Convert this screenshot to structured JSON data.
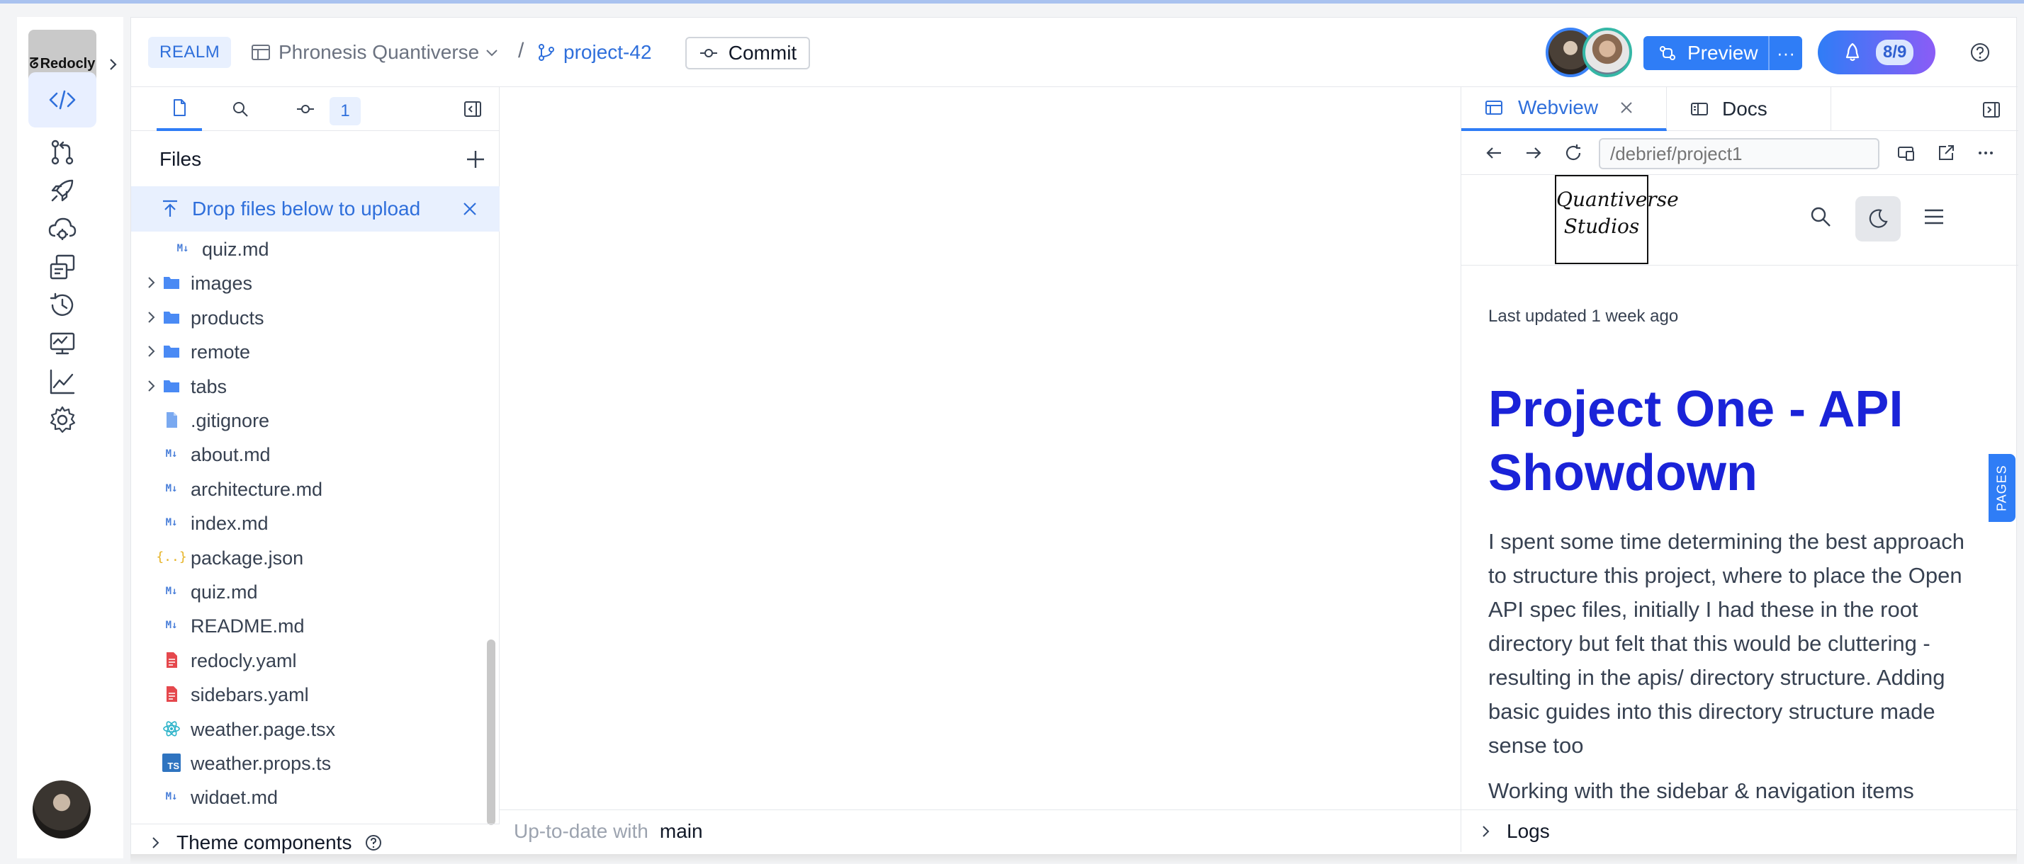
{
  "rail": {
    "logo_text": "Redocly",
    "items": [
      {
        "name": "code-icon",
        "active": true
      },
      {
        "name": "pull-request-icon",
        "active": false
      },
      {
        "name": "rocket-icon",
        "active": false
      },
      {
        "name": "cloud-gear-icon",
        "active": false
      },
      {
        "name": "api-icon",
        "active": false
      },
      {
        "name": "history-icon",
        "active": false
      },
      {
        "name": "monitor-icon",
        "active": false
      },
      {
        "name": "analytics-icon",
        "active": false
      },
      {
        "name": "settings-icon",
        "active": false
      }
    ]
  },
  "header": {
    "realm": "REALM",
    "project": "Phronesis Quantiverse",
    "separator": "/",
    "branch": "project-42",
    "commit_label": "Commit",
    "preview_label": "Preview",
    "preview_more": "···",
    "notif_count": "8/9"
  },
  "files_panel": {
    "change_count": "1",
    "title": "Files",
    "drop_banner": "Drop files below to upload",
    "tree": [
      {
        "type": "md",
        "name": "quiz.md",
        "indent": 1
      },
      {
        "type": "folder",
        "name": "images",
        "indent": 0
      },
      {
        "type": "folder",
        "name": "products",
        "indent": 0
      },
      {
        "type": "folder",
        "name": "remote",
        "indent": 0
      },
      {
        "type": "folder",
        "name": "tabs",
        "indent": 0
      },
      {
        "type": "file",
        "name": ".gitignore",
        "indent": 0
      },
      {
        "type": "md",
        "name": "about.md",
        "indent": 0
      },
      {
        "type": "md",
        "name": "architecture.md",
        "indent": 0
      },
      {
        "type": "md",
        "name": "index.md",
        "indent": 0
      },
      {
        "type": "json",
        "name": "package.json",
        "indent": 0
      },
      {
        "type": "md",
        "name": "quiz.md",
        "indent": 0
      },
      {
        "type": "md",
        "name": "README.md",
        "indent": 0
      },
      {
        "type": "yaml",
        "name": "redocly.yaml",
        "indent": 0
      },
      {
        "type": "yaml",
        "name": "sidebars.yaml",
        "indent": 0
      },
      {
        "type": "react",
        "name": "weather.page.tsx",
        "indent": 0
      },
      {
        "type": "ts",
        "name": "weather.props.ts",
        "indent": 0
      },
      {
        "type": "md",
        "name": "widget.md",
        "indent": 0
      }
    ],
    "theme_components": "Theme components"
  },
  "statusbar": {
    "label": "Up-to-date with",
    "branch": "main"
  },
  "right_panel": {
    "tab_webview": "Webview",
    "tab_docs": "Docs",
    "url_placeholder": "/debrief/project1",
    "logs": "Logs"
  },
  "webview": {
    "logo_line1": "Quantiverse",
    "logo_line2": "Studios",
    "updated": "Last updated 1 week ago",
    "title": "Project One - API Showdown",
    "para1": "I spent some time determining the best approach to structure this project, where to place the Open API spec files, initially I had these in the root directory but felt that this would be cluttering - resulting in the apis/ directory structure. Adding basic guides into this directory structure made sense too",
    "para2": "Working with the sidebar & navigation items",
    "pages_tab": "PAGES"
  },
  "colors": {
    "accent": "#2f7df6",
    "title_blue": "#1a23d8",
    "folder": "#4a8af4",
    "yaml": "#e5484d"
  }
}
